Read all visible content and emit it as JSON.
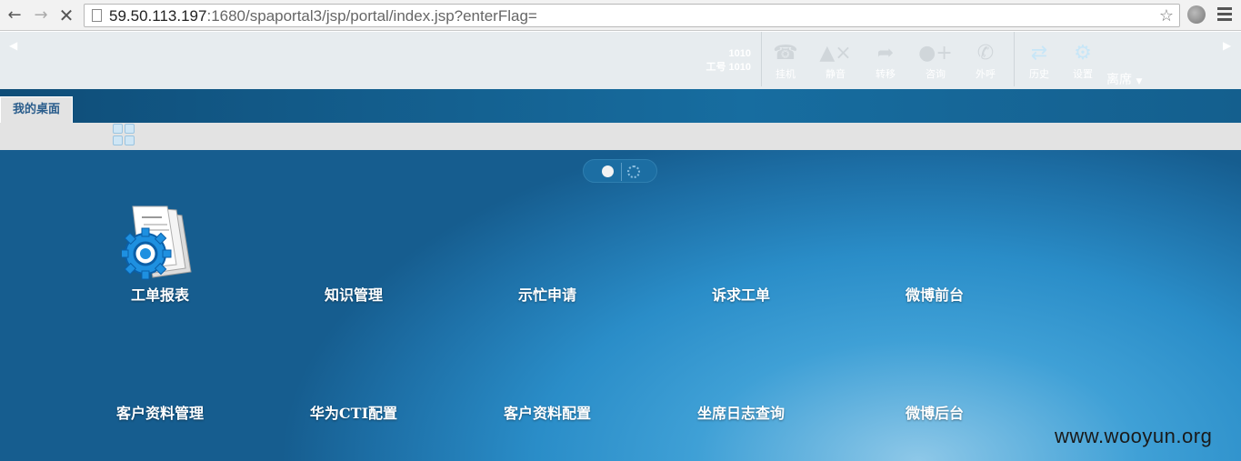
{
  "browser": {
    "url_host": "59.50.113.197",
    "url_rest": ":1680/spaportal3/jsp/portal/index.jsp?enterFlag="
  },
  "toolbar": {
    "agent_ext": "1010",
    "agent_id": "工号 1010",
    "buttons": [
      {
        "label": "挂机",
        "icon": "hangup-icon"
      },
      {
        "label": "静音",
        "icon": "mute-icon"
      },
      {
        "label": "转移",
        "icon": "transfer-icon"
      },
      {
        "label": "咨询",
        "icon": "consult-icon"
      },
      {
        "label": "外呼",
        "icon": "outbound-call-icon"
      },
      {
        "label": "历史",
        "icon": "history-icon"
      },
      {
        "label": "设置",
        "icon": "settings-icon"
      }
    ],
    "seat_status": "离席"
  },
  "tabs": [
    {
      "label": "我的桌面"
    }
  ],
  "desktop": {
    "apps": [
      {
        "label": "工单报表"
      },
      {
        "label": "知识管理"
      },
      {
        "label": "示忙申请"
      },
      {
        "label": "诉求工单"
      },
      {
        "label": "微博前台"
      },
      {
        "label": "客户资料管理"
      },
      {
        "label": "华为CTI配置"
      },
      {
        "label": "客户资料配置"
      },
      {
        "label": "坐席日志查询"
      },
      {
        "label": "微博后台"
      }
    ]
  },
  "watermark": "www.wooyun.org"
}
